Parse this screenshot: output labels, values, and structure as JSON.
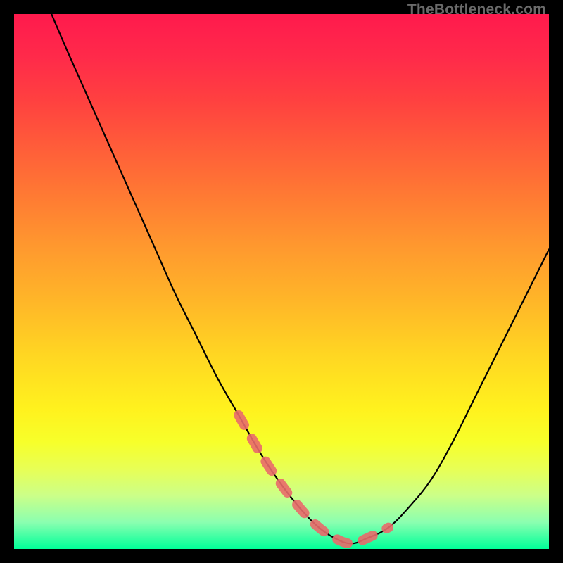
{
  "watermark": "TheBottleneck.com",
  "colors": {
    "frame": "#000000",
    "gradient_top": "#ff1a4d",
    "gradient_bottom": "#00ff99",
    "curve": "#000000",
    "curve_highlight": "#e96a6a"
  },
  "chart_data": {
    "type": "line",
    "title": "",
    "xlabel": "",
    "ylabel": "",
    "xlim": [
      0,
      100
    ],
    "ylim": [
      0,
      100
    ],
    "series": [
      {
        "name": "bottleneck-curve",
        "x": [
          7,
          10,
          14,
          18,
          22,
          26,
          30,
          34,
          38,
          42,
          46,
          50,
          54,
          57,
          60,
          63,
          66,
          70,
          74,
          78,
          82,
          86,
          90,
          94,
          98,
          100
        ],
        "values": [
          100,
          93,
          84,
          75,
          66,
          57,
          48,
          40,
          32,
          25,
          18,
          12,
          7,
          4,
          2,
          1,
          2,
          4,
          8,
          13,
          20,
          28,
          36,
          44,
          52,
          56
        ]
      }
    ],
    "highlight_range_x": [
      42,
      72
    ],
    "annotations": []
  }
}
